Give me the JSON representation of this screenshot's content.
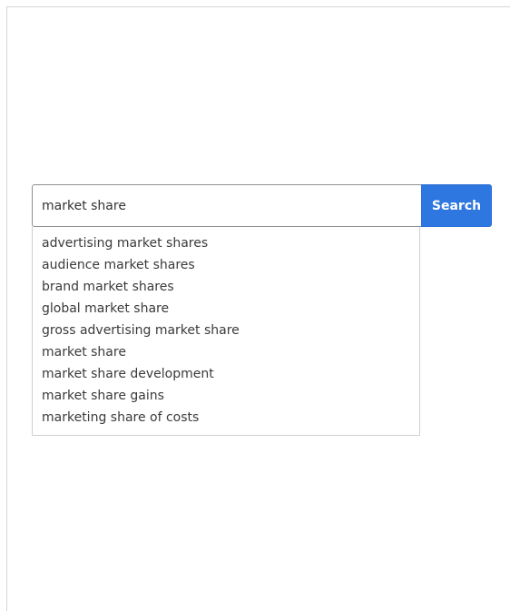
{
  "search": {
    "value": "market share",
    "button_label": "Search",
    "suggestions": [
      "advertising market shares",
      "audience market shares",
      "brand market shares",
      "global market share",
      "gross advertising market share",
      "market share",
      "market share development",
      "market share gains",
      "marketing share of costs"
    ]
  },
  "colors": {
    "button_background": "#2f77e0",
    "button_text": "#ffffff",
    "input_border": "#8f8f8f",
    "dropdown_border": "#cfcfcf",
    "text": "#3a3a3a"
  }
}
